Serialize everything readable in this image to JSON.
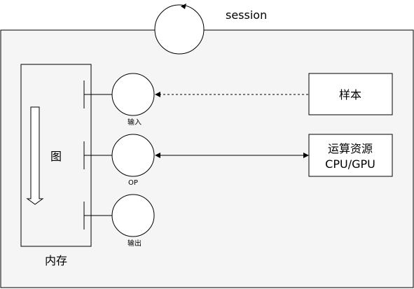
{
  "session": {
    "label": "session"
  },
  "memory": {
    "label": "内存",
    "graph_label": "图"
  },
  "nodes": [
    {
      "id": "input",
      "label": "输入"
    },
    {
      "id": "op",
      "label": "OP"
    },
    {
      "id": "output",
      "label": "输出"
    }
  ],
  "boxes": {
    "samples": {
      "label": "样本"
    },
    "compute": {
      "line1": "运算资源",
      "line2": "CPU/GPU"
    }
  },
  "colors": {
    "container_fill": "#f5f5f5",
    "stroke": "#000000",
    "box_fill": "#ffffff"
  }
}
